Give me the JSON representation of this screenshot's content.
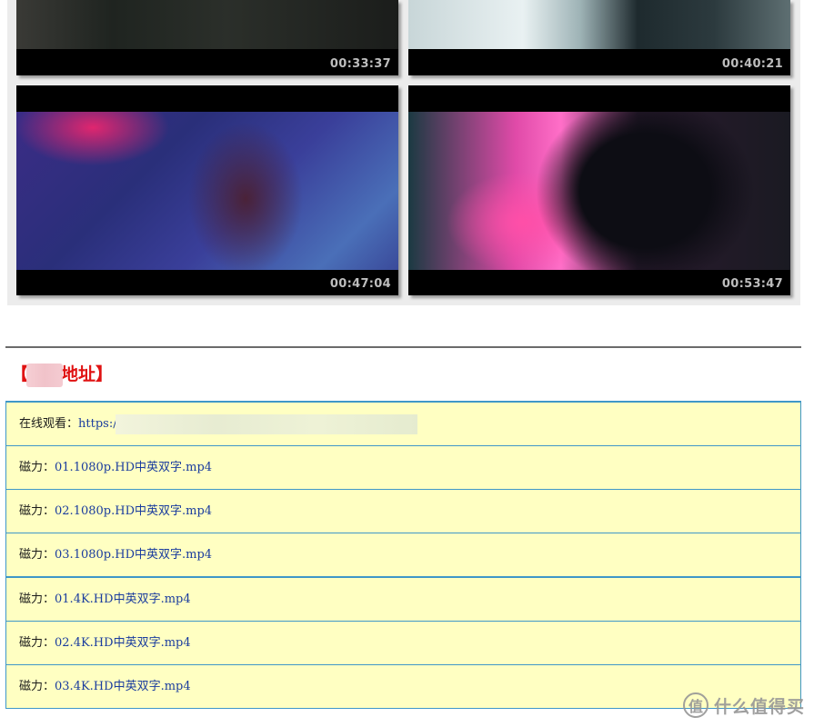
{
  "thumbnails": [
    {
      "timestamp": "00:33:37"
    },
    {
      "timestamp": "00:40:21"
    },
    {
      "timestamp": "00:47:04"
    },
    {
      "timestamp": "00:53:47"
    }
  ],
  "section": {
    "title_prefix": "【",
    "title_suffix": "地址】"
  },
  "links": [
    {
      "label": "在线观看：",
      "value": "https:/"
    },
    {
      "label": "磁力：",
      "value": "01.1080p.HD中英双字.mp4"
    },
    {
      "label": "磁力：",
      "value": "02.1080p.HD中英双字.mp4"
    },
    {
      "label": "磁力：",
      "value": "03.1080p.HD中英双字.mp4"
    },
    {
      "label": "磁力：",
      "value": "01.4K.HD中英双字.mp4"
    },
    {
      "label": "磁力：",
      "value": "02.4K.HD中英双字.mp4"
    },
    {
      "label": "磁力：",
      "value": "03.4K.HD中英双字.mp4"
    }
  ],
  "watermark": {
    "badge": "值",
    "text": "什么值得买"
  },
  "colors": {
    "title_red": "#e01212",
    "row_bg": "#ffffc2",
    "border_blue": "#3f97c8",
    "link_blue": "#1a3c9e"
  }
}
